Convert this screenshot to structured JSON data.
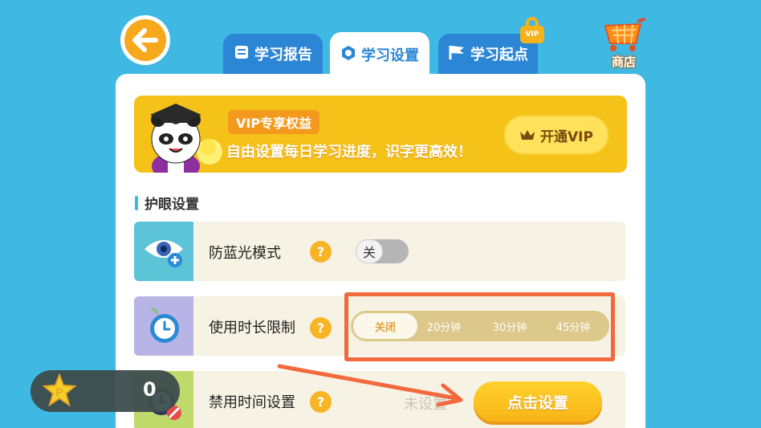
{
  "colors": {
    "background": "#3fb8e4",
    "tab_active_text": "#2b86d6",
    "tab_inactive_bg": "#2b86d6",
    "vip_banner": "#f5c21a",
    "accent_orange": "#f7b526",
    "highlight_border": "#f2693e"
  },
  "tabs": [
    {
      "label": "学习报告",
      "icon": "book-icon",
      "active": false
    },
    {
      "label": "学习设置",
      "icon": "gear-icon",
      "active": true
    },
    {
      "label": "学习起点",
      "icon": "flag-icon",
      "active": false
    }
  ],
  "lock_badge": "VIP",
  "shop_label": "商店",
  "vip_banner": {
    "tag": "VIP专享权益",
    "description": "自由设置每日学习进度，识字更高效！",
    "button": "开通VIP"
  },
  "eye_care": {
    "section_title": "护眼设置",
    "rows": [
      {
        "label": "防蓝光模式",
        "toggle_state": "关",
        "icon": "eye-icon"
      },
      {
        "label": "使用时长限制",
        "icon": "timer-icon",
        "options": [
          "关闭",
          "20分钟",
          "30分钟",
          "45分钟"
        ],
        "selected": "关闭"
      },
      {
        "label": "禁用时间设置",
        "icon": "no-clock-icon",
        "status": "未设置",
        "button": "点击设置"
      }
    ]
  },
  "help_glyph": "?",
  "coins": {
    "count": "0",
    "icon_letter": "P"
  }
}
